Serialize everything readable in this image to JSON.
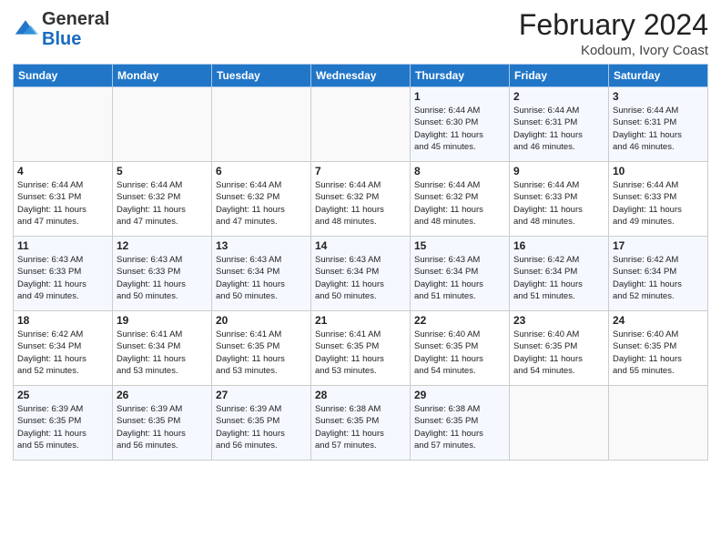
{
  "logo": {
    "general": "General",
    "blue": "Blue"
  },
  "header": {
    "title": "February 2024",
    "subtitle": "Kodoum, Ivory Coast"
  },
  "weekdays": [
    "Sunday",
    "Monday",
    "Tuesday",
    "Wednesday",
    "Thursday",
    "Friday",
    "Saturday"
  ],
  "weeks": [
    [
      {
        "day": "",
        "info": ""
      },
      {
        "day": "",
        "info": ""
      },
      {
        "day": "",
        "info": ""
      },
      {
        "day": "",
        "info": ""
      },
      {
        "day": "1",
        "info": "Sunrise: 6:44 AM\nSunset: 6:30 PM\nDaylight: 11 hours\nand 45 minutes."
      },
      {
        "day": "2",
        "info": "Sunrise: 6:44 AM\nSunset: 6:31 PM\nDaylight: 11 hours\nand 46 minutes."
      },
      {
        "day": "3",
        "info": "Sunrise: 6:44 AM\nSunset: 6:31 PM\nDaylight: 11 hours\nand 46 minutes."
      }
    ],
    [
      {
        "day": "4",
        "info": "Sunrise: 6:44 AM\nSunset: 6:31 PM\nDaylight: 11 hours\nand 47 minutes."
      },
      {
        "day": "5",
        "info": "Sunrise: 6:44 AM\nSunset: 6:32 PM\nDaylight: 11 hours\nand 47 minutes."
      },
      {
        "day": "6",
        "info": "Sunrise: 6:44 AM\nSunset: 6:32 PM\nDaylight: 11 hours\nand 47 minutes."
      },
      {
        "day": "7",
        "info": "Sunrise: 6:44 AM\nSunset: 6:32 PM\nDaylight: 11 hours\nand 48 minutes."
      },
      {
        "day": "8",
        "info": "Sunrise: 6:44 AM\nSunset: 6:32 PM\nDaylight: 11 hours\nand 48 minutes."
      },
      {
        "day": "9",
        "info": "Sunrise: 6:44 AM\nSunset: 6:33 PM\nDaylight: 11 hours\nand 48 minutes."
      },
      {
        "day": "10",
        "info": "Sunrise: 6:44 AM\nSunset: 6:33 PM\nDaylight: 11 hours\nand 49 minutes."
      }
    ],
    [
      {
        "day": "11",
        "info": "Sunrise: 6:43 AM\nSunset: 6:33 PM\nDaylight: 11 hours\nand 49 minutes."
      },
      {
        "day": "12",
        "info": "Sunrise: 6:43 AM\nSunset: 6:33 PM\nDaylight: 11 hours\nand 50 minutes."
      },
      {
        "day": "13",
        "info": "Sunrise: 6:43 AM\nSunset: 6:34 PM\nDaylight: 11 hours\nand 50 minutes."
      },
      {
        "day": "14",
        "info": "Sunrise: 6:43 AM\nSunset: 6:34 PM\nDaylight: 11 hours\nand 50 minutes."
      },
      {
        "day": "15",
        "info": "Sunrise: 6:43 AM\nSunset: 6:34 PM\nDaylight: 11 hours\nand 51 minutes."
      },
      {
        "day": "16",
        "info": "Sunrise: 6:42 AM\nSunset: 6:34 PM\nDaylight: 11 hours\nand 51 minutes."
      },
      {
        "day": "17",
        "info": "Sunrise: 6:42 AM\nSunset: 6:34 PM\nDaylight: 11 hours\nand 52 minutes."
      }
    ],
    [
      {
        "day": "18",
        "info": "Sunrise: 6:42 AM\nSunset: 6:34 PM\nDaylight: 11 hours\nand 52 minutes."
      },
      {
        "day": "19",
        "info": "Sunrise: 6:41 AM\nSunset: 6:34 PM\nDaylight: 11 hours\nand 53 minutes."
      },
      {
        "day": "20",
        "info": "Sunrise: 6:41 AM\nSunset: 6:35 PM\nDaylight: 11 hours\nand 53 minutes."
      },
      {
        "day": "21",
        "info": "Sunrise: 6:41 AM\nSunset: 6:35 PM\nDaylight: 11 hours\nand 53 minutes."
      },
      {
        "day": "22",
        "info": "Sunrise: 6:40 AM\nSunset: 6:35 PM\nDaylight: 11 hours\nand 54 minutes."
      },
      {
        "day": "23",
        "info": "Sunrise: 6:40 AM\nSunset: 6:35 PM\nDaylight: 11 hours\nand 54 minutes."
      },
      {
        "day": "24",
        "info": "Sunrise: 6:40 AM\nSunset: 6:35 PM\nDaylight: 11 hours\nand 55 minutes."
      }
    ],
    [
      {
        "day": "25",
        "info": "Sunrise: 6:39 AM\nSunset: 6:35 PM\nDaylight: 11 hours\nand 55 minutes."
      },
      {
        "day": "26",
        "info": "Sunrise: 6:39 AM\nSunset: 6:35 PM\nDaylight: 11 hours\nand 56 minutes."
      },
      {
        "day": "27",
        "info": "Sunrise: 6:39 AM\nSunset: 6:35 PM\nDaylight: 11 hours\nand 56 minutes."
      },
      {
        "day": "28",
        "info": "Sunrise: 6:38 AM\nSunset: 6:35 PM\nDaylight: 11 hours\nand 57 minutes."
      },
      {
        "day": "29",
        "info": "Sunrise: 6:38 AM\nSunset: 6:35 PM\nDaylight: 11 hours\nand 57 minutes."
      },
      {
        "day": "",
        "info": ""
      },
      {
        "day": "",
        "info": ""
      }
    ]
  ]
}
